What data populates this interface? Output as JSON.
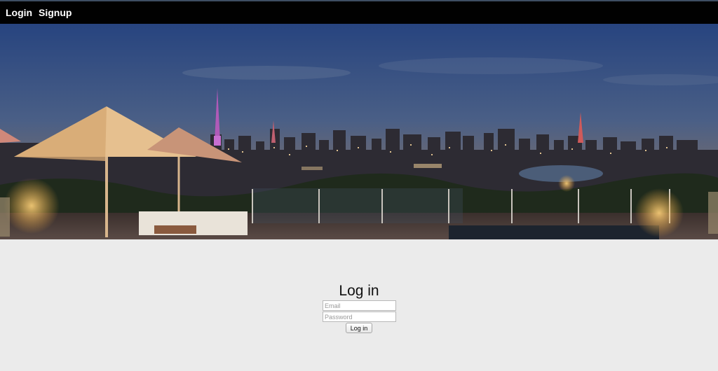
{
  "nav": {
    "login_label": "Login",
    "signup_label": "Signup"
  },
  "hero": {
    "image": "city-skyline-rooftop-night-photo"
  },
  "login_form": {
    "title": "Log in",
    "email_placeholder": "Email",
    "password_placeholder": "Password",
    "submit_label": "Log in"
  },
  "colors": {
    "topbar": "#010101",
    "page_background": "#ebebeb",
    "nav_text": "#ffffff"
  }
}
